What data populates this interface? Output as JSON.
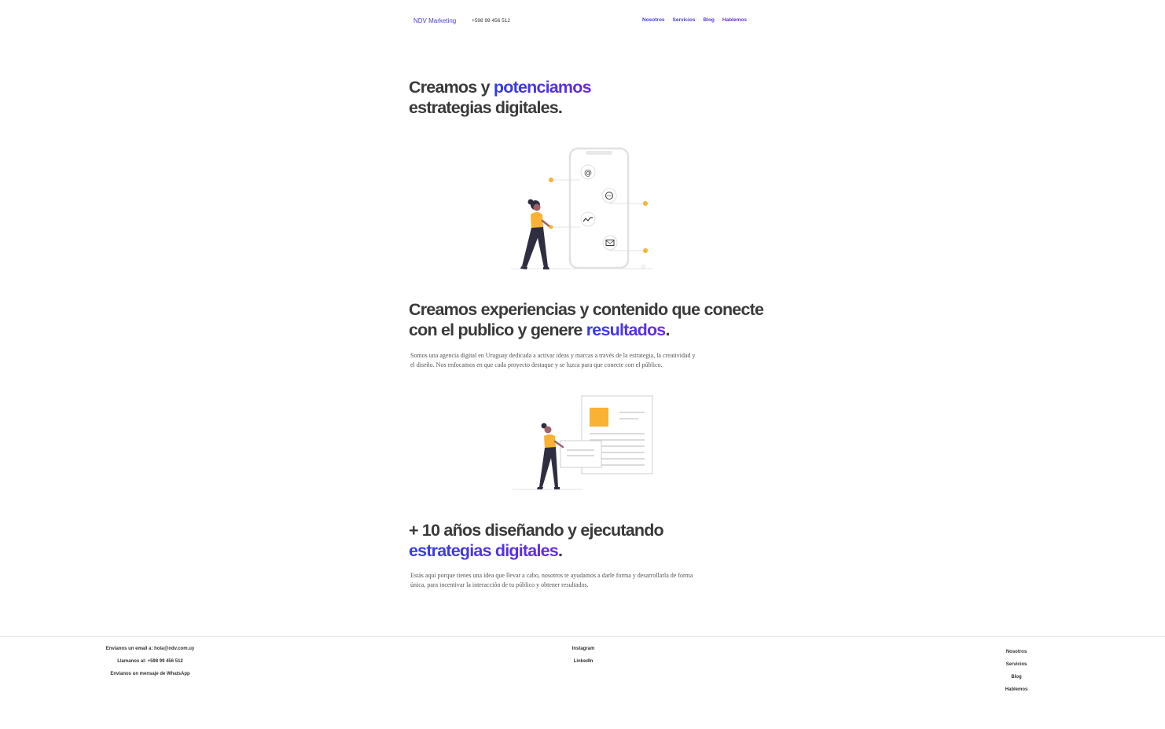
{
  "header": {
    "brand": "NDV Marketing",
    "phone": "+598 99 456 512",
    "nav": [
      "Nosotros",
      "Servicios",
      "Blog",
      "Hablemos"
    ]
  },
  "hero": {
    "line1_a": "Creamos y ",
    "line1_b": "potenciamos",
    "line2": "estrategias digitales."
  },
  "experience": {
    "heading_a": "Creamos experiencias y contenido que conecte con el publico y genere ",
    "heading_b": "resultados",
    "heading_c": ".",
    "body": "Somos una agencia digital en Uruguay dedicada a activar ideas y marcas a través de la estrategia, la creatividad y el diseño. Nos enfocamos en que cada proyecto destaque y se luzca para que conecte con el público."
  },
  "years": {
    "line1": "+ 10 años diseñando y ejecutando",
    "line2_a": "estrategias digitales",
    "line2_b": ".",
    "body": "Estás aquí porque tienes una idea que llevar a cabo, nosotros te ayudamos a darle forma y desarrollarla de forma única, para incentivar la interacción de tu público y obtener resultados."
  },
  "footer": {
    "contact": [
      "Envianos un email a: hola@ndv.com.uy",
      "Llamanos al: +598 99 456 512",
      "Envianos un mensaje de WhatsApp"
    ],
    "social": [
      "Instagram",
      "LinkedIn"
    ],
    "nav": [
      "Nosotros",
      "Servicios",
      "Blog",
      "Hablemos"
    ]
  },
  "colors": {
    "accent_start": "#2f3ee6",
    "accent_end": "#6a2be0",
    "illustration_yellow": "#f9b233",
    "text": "#3a3a3a"
  },
  "icons": [
    "at-icon",
    "chat-icon",
    "trend-icon",
    "mail-icon"
  ]
}
